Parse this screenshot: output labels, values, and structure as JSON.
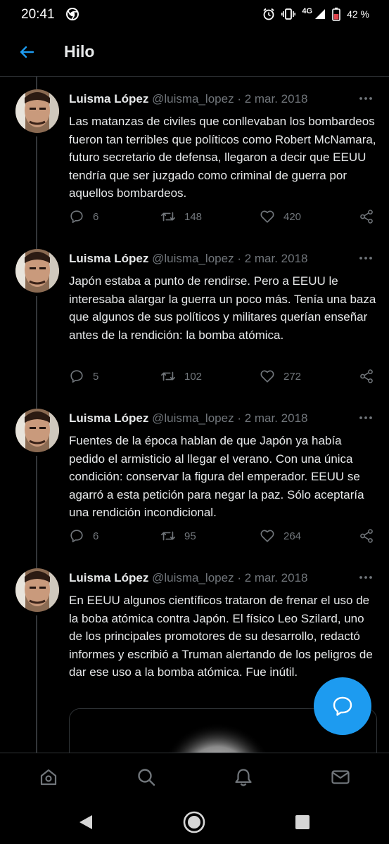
{
  "status_bar": {
    "time": "20:41",
    "network": "4G",
    "battery": "42 %"
  },
  "header": {
    "title": "Hilo"
  },
  "tweets": [
    {
      "name": "Luisma López",
      "handle": "@luisma_lopez",
      "sep": "·",
      "date": "2 mar. 2018",
      "text": "Las matanzas de civiles que conllevaban los bombardeos fueron tan terribles que políticos como Robert McNamara, futuro secretario de defensa, llegaron a decir que EEUU tendría que ser juzgado como criminal de guerra por aquellos bombardeos.",
      "replies": "6",
      "retweets": "148",
      "likes": "420"
    },
    {
      "name": "Luisma López",
      "handle": "@luisma_lopez",
      "sep": "·",
      "date": "2 mar. 2018",
      "text": "Japón estaba a punto de rendirse. Pero a EEUU le interesaba alargar la guerra un poco más. Tenía una baza que algunos de sus políticos y militares querían enseñar antes de la rendición: la bomba atómica.",
      "replies": "5",
      "retweets": "102",
      "likes": "272"
    },
    {
      "name": "Luisma López",
      "handle": "@luisma_lopez",
      "sep": "·",
      "date": "2 mar. 2018",
      "text": "Fuentes de la época hablan de que Japón ya había pedido el armisticio al llegar el verano. Con una única condición: conservar la figura del emperador. EEUU se agarró a esta petición para negar la paz. Sólo aceptaría una rendición incondicional.",
      "replies": "6",
      "retweets": "95",
      "likes": "264"
    },
    {
      "name": "Luisma López",
      "handle": "@luisma_lopez",
      "sep": "·",
      "date": "2 mar. 2018",
      "text": "En EEUU algunos científicos trataron de frenar el uso de la boba atómica contra Japón. El físico Leo Szilard, uno de los principales promotores de su desarrollo, redactó informes y escribió a Truman alertando de los peligros de dar ese uso a la bomba atómica. Fue inútil."
    }
  ],
  "icons": {
    "back": "arrow-left-icon",
    "more": "more-icon",
    "reply": "reply-icon",
    "retweet": "retweet-icon",
    "like": "heart-icon",
    "share": "share-icon",
    "compose": "compose-message-icon",
    "home": "home-icon",
    "search": "search-icon",
    "notifications": "bell-icon",
    "messages": "mail-icon"
  },
  "colors": {
    "accent": "#1d9bf0",
    "background": "#000000",
    "text": "#e7e9ea",
    "secondary": "#71767b"
  }
}
